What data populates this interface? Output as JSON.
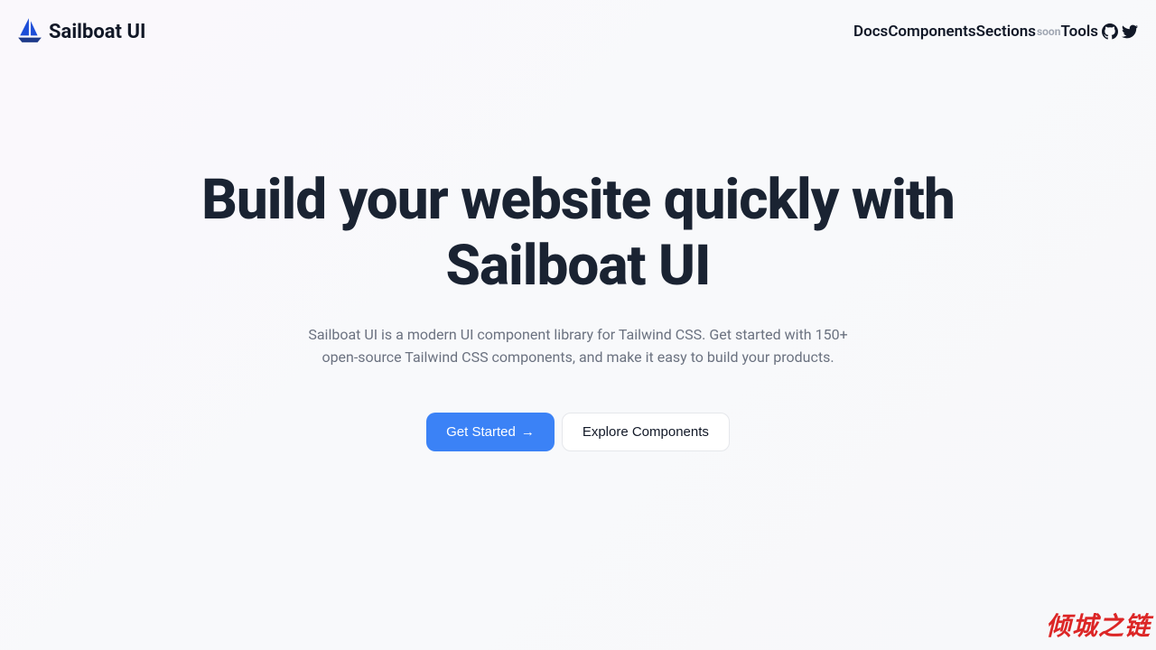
{
  "brand": {
    "name": "Sailboat UI"
  },
  "nav": {
    "items": [
      {
        "label": "Docs"
      },
      {
        "label": "Components"
      },
      {
        "label": "Sections",
        "badge": "soon"
      },
      {
        "label": "Tools"
      }
    ]
  },
  "hero": {
    "title": "Build your website quickly with Sailboat UI",
    "description": "Sailboat UI is a modern UI component library for Tailwind CSS. Get started with 150+ open-source Tailwind CSS components, and make it easy to build your products.",
    "primary_cta": "Get Started",
    "secondary_cta": "Explore Components"
  },
  "watermark": "倾城之链"
}
